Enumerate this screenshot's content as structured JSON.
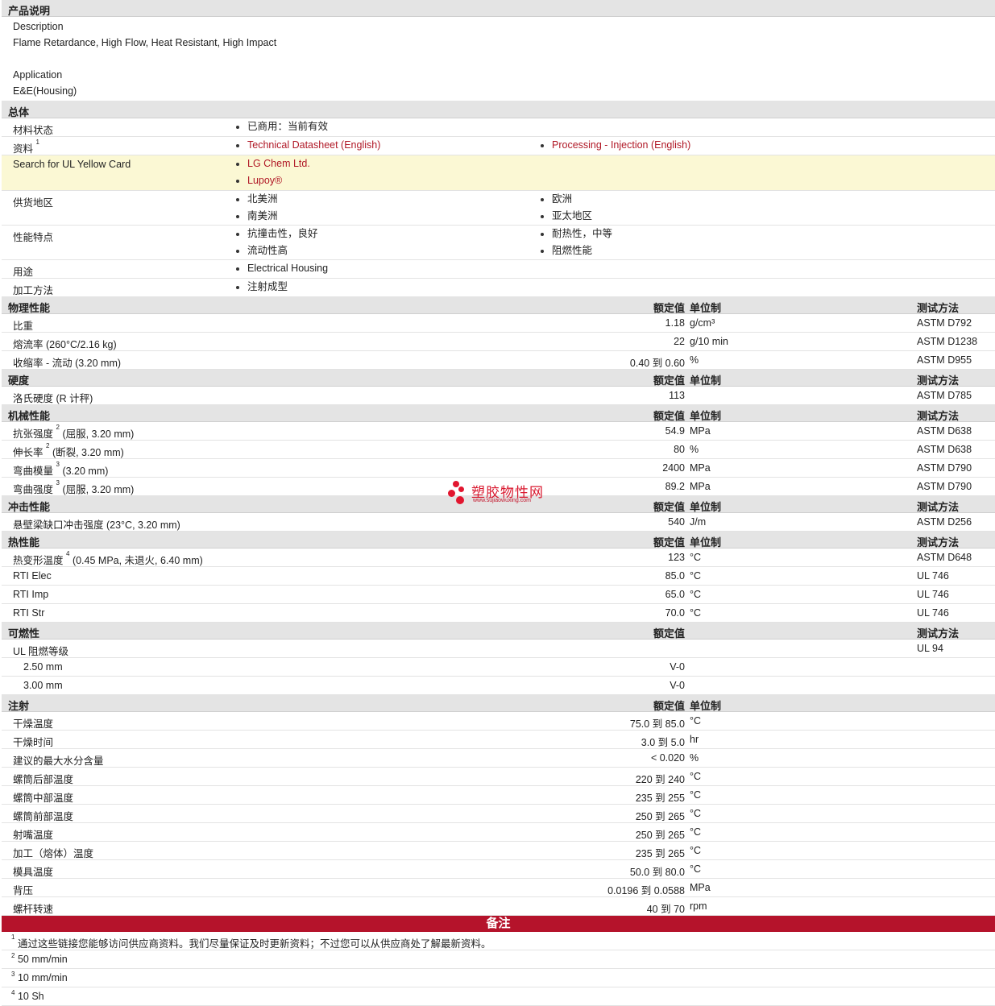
{
  "description": {
    "header": "产品说明",
    "description_label": "Description",
    "description_text": "Flame Retardance, High Flow, Heat Resistant, High Impact",
    "application_label": "Application",
    "application_text": "E&E(Housing)"
  },
  "general": {
    "header": "总体",
    "rows": {
      "status": {
        "label": "材料状态",
        "items": [
          "已商用：当前有效"
        ]
      },
      "literature": {
        "label": "资料",
        "sup": "1",
        "items": [
          "Technical Datasheet (English)",
          "Processing - Injection (English)"
        ]
      },
      "ul_card": {
        "label": "Search for UL Yellow Card",
        "items": [
          "LG Chem Ltd.",
          "Lupoy®"
        ]
      },
      "availability": {
        "label": "供货地区",
        "items": [
          "北美洲",
          "欧洲",
          "南美洲",
          "亚太地区"
        ]
      },
      "features": {
        "label": "性能特点",
        "items": [
          "抗撞击性，良好",
          "耐热性，中等",
          "流动性高",
          "阻燃性能"
        ]
      },
      "uses": {
        "label": "用途",
        "items": [
          "Electrical Housing"
        ]
      },
      "processing": {
        "label": "加工方法",
        "items": [
          "注射成型"
        ]
      }
    }
  },
  "columns": {
    "nominal": "额定值",
    "unit": "单位制",
    "method": "测试方法"
  },
  "physical": {
    "header": "物理性能",
    "rows": [
      {
        "label": "比重",
        "value": "1.18",
        "unit": "g/cm³",
        "method": "ASTM D792"
      },
      {
        "label": "熔流率  (260°C/2.16 kg)",
        "value": "22",
        "unit": "g/10 min",
        "method": "ASTM D1238"
      },
      {
        "label": "收缩率  - 流动  (3.20 mm)",
        "value": "0.40  到  0.60",
        "unit": "%",
        "method": "ASTM D955"
      }
    ]
  },
  "hardness": {
    "header": "硬度",
    "rows": [
      {
        "label": "洛氏硬度  (R 计秤)",
        "value": "113",
        "unit": "",
        "method": "ASTM D785"
      }
    ]
  },
  "mechanical": {
    "header": "机械性能",
    "rows": [
      {
        "label_a": "抗张强度",
        "sup": "2",
        "label_b": "(屈服, 3.20 mm)",
        "value": "54.9",
        "unit": "MPa",
        "method": "ASTM D638"
      },
      {
        "label_a": "伸长率",
        "sup": "2",
        "label_b": "(断裂, 3.20 mm)",
        "value": "80",
        "unit": "%",
        "method": "ASTM D638"
      },
      {
        "label_a": "弯曲模量",
        "sup": "3",
        "label_b": "(3.20 mm)",
        "value": "2400",
        "unit": "MPa",
        "method": "ASTM D790"
      },
      {
        "label_a": "弯曲强度",
        "sup": "3",
        "label_b": "(屈服, 3.20 mm)",
        "value": "89.2",
        "unit": "MPa",
        "method": "ASTM D790"
      }
    ]
  },
  "impact": {
    "header": "冲击性能",
    "rows": [
      {
        "label": "悬壁梁缺口冲击强度  (23°C, 3.20 mm)",
        "value": "540",
        "unit": "J/m",
        "method": "ASTM D256"
      }
    ]
  },
  "thermal": {
    "header": "热性能",
    "rows": [
      {
        "label_a": "热变形温度",
        "sup": "4",
        "label_b": "(0.45 MPa, 未退火, 6.40 mm)",
        "value": "123",
        "unit": "°C",
        "method": "ASTM D648"
      },
      {
        "label": "RTI Elec",
        "value": "85.0",
        "unit": "°C",
        "method": "UL 746"
      },
      {
        "label": "RTI Imp",
        "value": "65.0",
        "unit": "°C",
        "method": "UL 746"
      },
      {
        "label": "RTI Str",
        "value": "70.0",
        "unit": "°C",
        "method": "UL 746"
      }
    ]
  },
  "flammability": {
    "header": "可燃性",
    "rows": [
      {
        "label": "UL 阻燃等级",
        "value": "",
        "method": "UL 94"
      },
      {
        "label": "2.50 mm",
        "value": "V-0",
        "method": ""
      },
      {
        "label": "3.00 mm",
        "value": "V-0",
        "method": ""
      }
    ]
  },
  "injection": {
    "header": "注射",
    "rows": [
      {
        "label": "干燥温度",
        "value": "75.0  到  85.0",
        "unit": "°C"
      },
      {
        "label": "干燥时间",
        "value": "3.0  到  5.0",
        "unit": "hr"
      },
      {
        "label": "建议的最大水分含量",
        "value": "< 0.020",
        "unit": "%"
      },
      {
        "label": "螺筒后部温度",
        "value": "220  到  240",
        "unit": "°C"
      },
      {
        "label": "螺筒中部温度",
        "value": "235  到  255",
        "unit": "°C"
      },
      {
        "label": "螺筒前部温度",
        "value": "250  到  265",
        "unit": "°C"
      },
      {
        "label": "射嘴温度",
        "value": "250  到  265",
        "unit": "°C"
      },
      {
        "label": "加工（熔体）温度",
        "value": "235  到  265",
        "unit": "°C"
      },
      {
        "label": "模具温度",
        "value": "50.0  到  80.0",
        "unit": "°C"
      },
      {
        "label": "背压",
        "value": "0.0196  到  0.0588",
        "unit": "MPa"
      },
      {
        "label": "螺杆转速",
        "value": "40  到  70",
        "unit": "rpm"
      }
    ]
  },
  "notes": {
    "header": "备注",
    "items": [
      {
        "num": "1",
        "text": "通过这些链接您能够访问供应商资料。我们尽量保证及时更新资料；不过您可以从供应商处了解最新资料。"
      },
      {
        "num": "2",
        "text": "50 mm/min"
      },
      {
        "num": "3",
        "text": "10 mm/min"
      },
      {
        "num": "4",
        "text": "10 Sh"
      }
    ]
  },
  "watermark": {
    "cn": "塑胶物性网",
    "en": "www.sujiaowuxing.com"
  },
  "colors": {
    "link": "#b01826",
    "notes_bar": "#b5132b",
    "header_bg": "#e4e4e4",
    "highlight_row": "#fbf8d4"
  }
}
